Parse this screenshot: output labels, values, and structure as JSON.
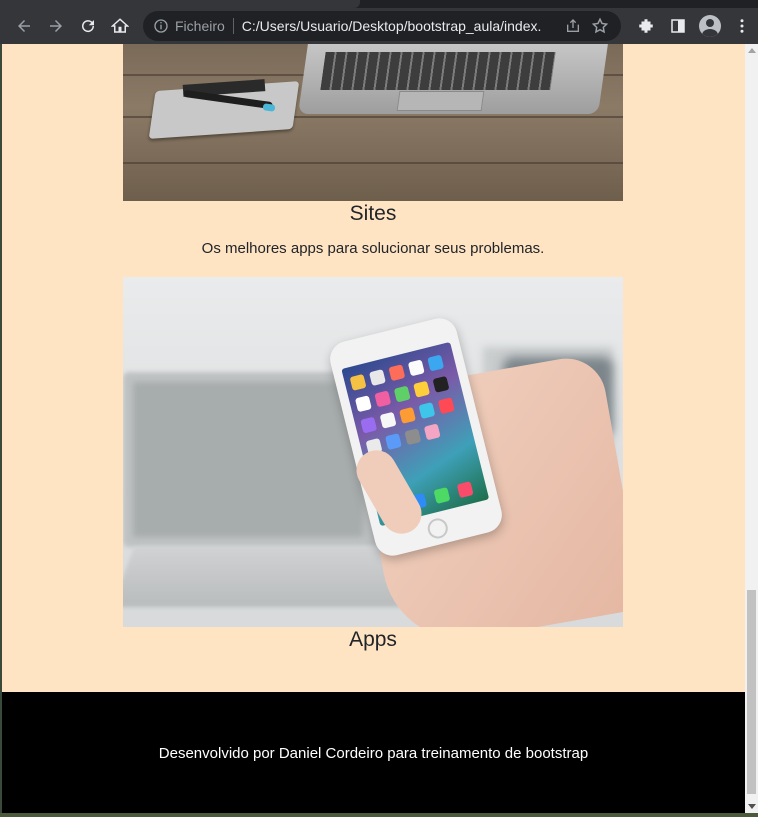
{
  "browser": {
    "address_scheme": "Ficheiro",
    "address_url": "C:/Users/Usuario/Desktop/bootstrap_aula/index...."
  },
  "content": {
    "items": [
      {
        "title": "Sites",
        "text": "Os melhores apps para solucionar seus problemas."
      },
      {
        "title": "Apps"
      }
    ]
  },
  "footer": {
    "text": "Desenvolvido por Daniel Cordeiro para treinamento de bootstrap"
  },
  "colors": {
    "page_background": "#ffe4c4",
    "footer_background": "#000000",
    "chrome": "#35363a"
  },
  "icons": [
    "back-icon",
    "forward-icon",
    "reload-icon",
    "home-icon",
    "info-icon",
    "share-icon",
    "star-icon",
    "extensions-icon",
    "side-panel-icon",
    "profile-icon",
    "menu-icon"
  ]
}
